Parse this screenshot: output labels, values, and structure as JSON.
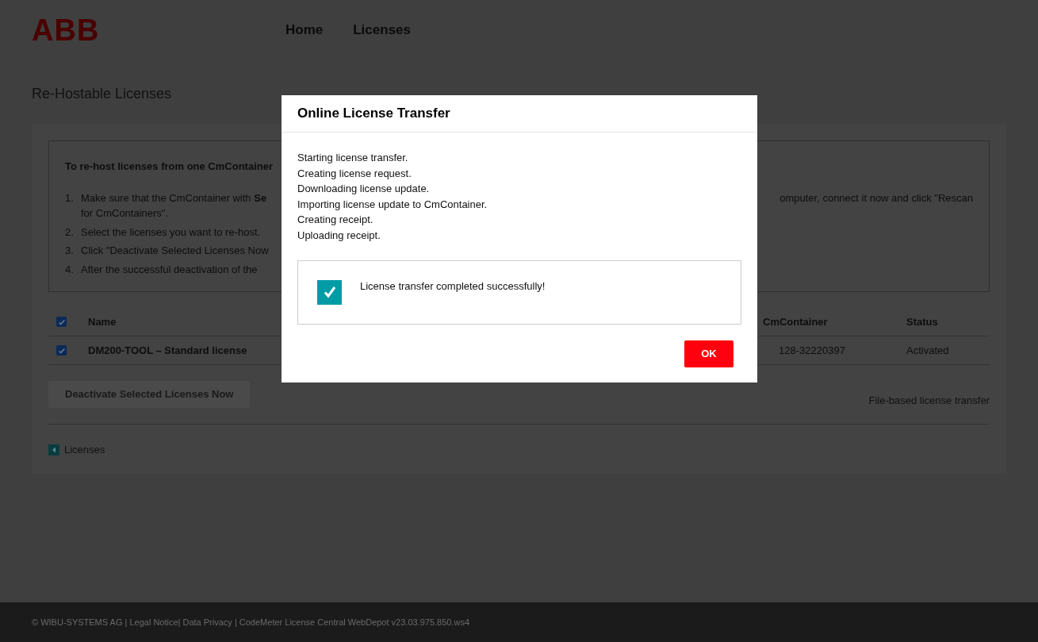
{
  "header": {
    "logo": "ABB",
    "nav": [
      {
        "label": "Home"
      },
      {
        "label": "Licenses"
      }
    ]
  },
  "page_title": "Re-Hostable Licenses",
  "instructions": {
    "heading": "To re-host licenses from one CmContainer",
    "steps": [
      {
        "number": "1.",
        "left": "Make sure that the CmContainer with **Se**",
        "right": "omputer, connect it now and click \"Rescan",
        "continuation": "for CmContainers\"."
      },
      {
        "number": "2.",
        "left": "Select the licenses you want to re-host."
      },
      {
        "number": "3.",
        "left": "Click \"Deactivate Selected Licenses Now"
      },
      {
        "number": "4.",
        "left": "After the successful deactivation of the"
      }
    ]
  },
  "table": {
    "select_all_checked": true,
    "columns": [
      "Name",
      "CmContainer",
      "Status"
    ],
    "rows": [
      {
        "checked": true,
        "name": "DM200-TOOL – Standard license",
        "cmcontainer": "128-32220397",
        "status": "Activated"
      }
    ]
  },
  "deactivate_button": {
    "label": "Deactivate Selected Licenses Now",
    "disabled": true
  },
  "file_transfer_link": "File-based license transfer",
  "back_link": "Licenses",
  "footer_text": "© WIBU-SYSTEMS AG | Legal Notice| Data Privacy | CodeMeter License Central WebDepot v23.03.975.850.ws4",
  "dialog": {
    "title": "Online License Transfer",
    "log": [
      "Starting license transfer.",
      "Creating license request.",
      "Downloading license update.",
      "Importing license update to CmContainer.",
      "Creating receipt.",
      "Uploading receipt."
    ],
    "result": {
      "checked": true,
      "message": "License transfer completed successfully!"
    },
    "ok_button": "OK"
  }
}
